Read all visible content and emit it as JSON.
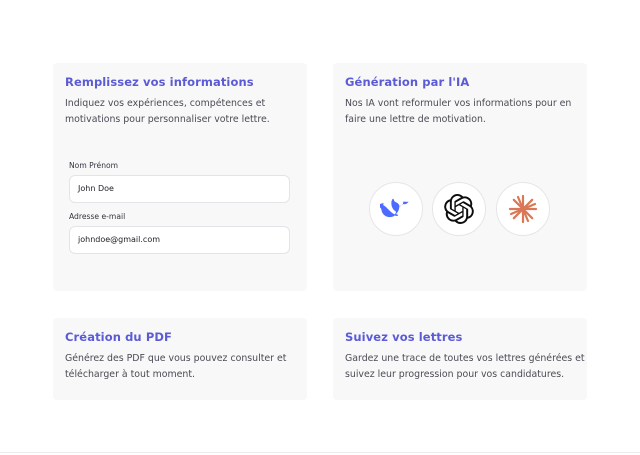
{
  "cards": {
    "fill_info": {
      "title": "Remplissez vos informations",
      "desc_line1": "Indiquez vos expériences, compétences et",
      "desc_line2": "motivations pour personnaliser votre lettre.",
      "name_label": "Nom Prénom",
      "name_value": "John Doe",
      "email_label": "Adresse e-mail",
      "email_value": "johndoe@gmail.com"
    },
    "ai_generation": {
      "title": "Génération par l'IA",
      "desc_line1": "Nos IA vont reformuler vos informations pour en",
      "desc_line2": "faire une lettre de motivation.",
      "icons": [
        "deepseek-whale-icon",
        "openai-knot-icon",
        "claude-starburst-icon"
      ]
    },
    "pdf_creation": {
      "title": "Création du PDF",
      "desc_line1": "Générez des PDF que vous pouvez consulter et",
      "desc_line2": "télécharger à tout moment."
    },
    "track_letters": {
      "title": "Suivez vos lettres",
      "desc_line1": "Gardez une trace de toutes vos lettres générées et",
      "desc_line2": "suivez leur progression pour vos candidatures."
    }
  },
  "colors": {
    "accent": "#5b5bd6",
    "deepseek_blue": "#4d6bfe",
    "claude_orange": "#d97757"
  }
}
